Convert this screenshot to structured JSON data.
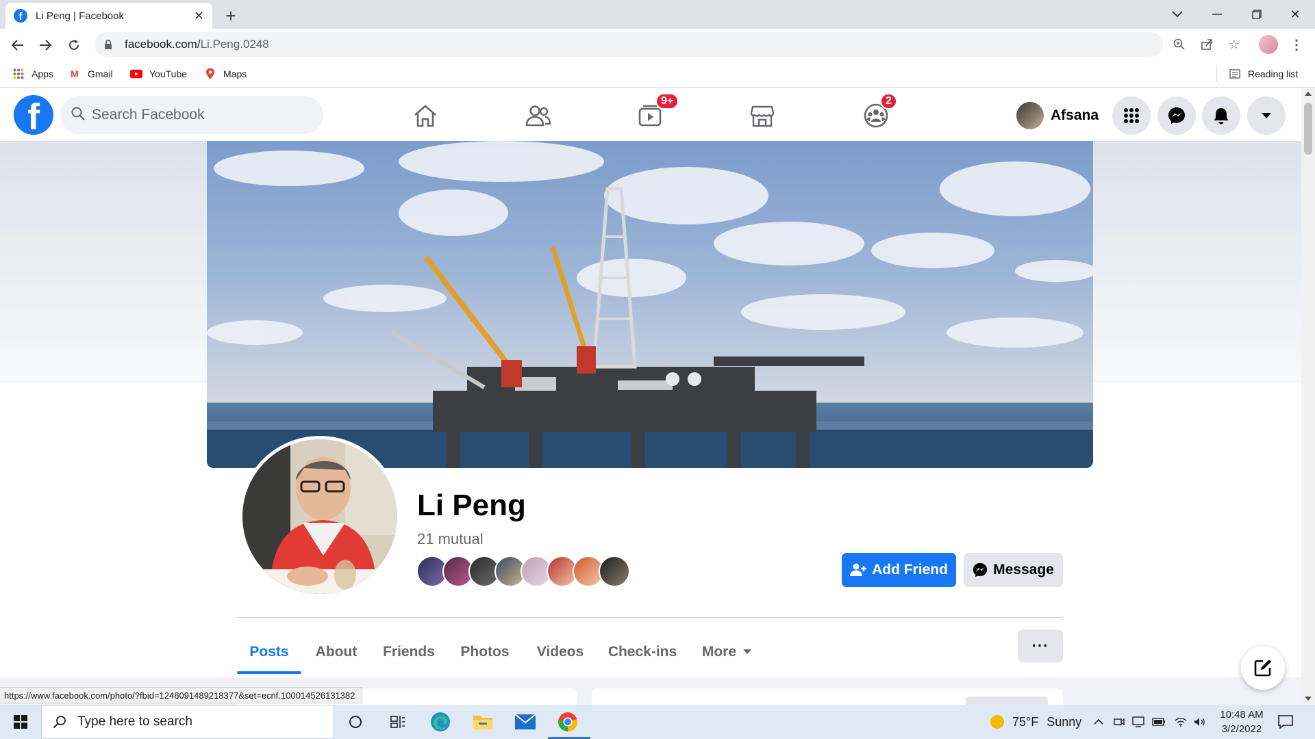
{
  "browser": {
    "tab_title": "Li Peng | Facebook",
    "url_host": "facebook.com/",
    "url_path": "Li.Peng.0248",
    "bookmarks": [
      "Apps",
      "Gmail",
      "YouTube",
      "Maps"
    ],
    "reading_list": "Reading list",
    "status_url": "https://www.facebook.com/photo/?fbid=1246091489218377&set=ecnf.100014526131382"
  },
  "facebook": {
    "search_placeholder": "Search Facebook",
    "watch_badge": "9+",
    "groups_badge": "2",
    "user_name": "Afsana"
  },
  "profile": {
    "name": "Li Peng",
    "mutual": "21 mutual",
    "add_friend_label": "Add Friend",
    "message_label": "Message",
    "tabs": [
      "Posts",
      "About",
      "Friends",
      "Photos",
      "Videos",
      "Check-ins",
      "More"
    ],
    "active_tab": "Posts",
    "more_options": "···"
  },
  "taskbar": {
    "search_placeholder": "Type here to search",
    "weather_temp": "75°F",
    "weather_desc": "Sunny",
    "time": "10:48 AM",
    "date": "3/2/2022"
  },
  "colors": {
    "facebook_blue": "#1877f2",
    "badge_red": "#e41e3f"
  }
}
